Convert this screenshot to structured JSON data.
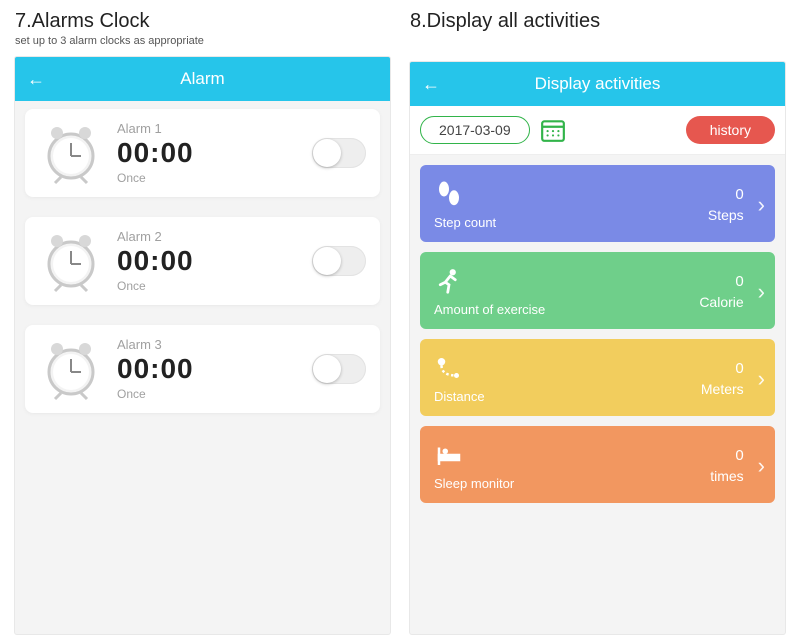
{
  "left": {
    "heading": "7.Alarms Clock",
    "sub": "set up to 3 alarm clocks as appropriate",
    "title": "Alarm",
    "alarms": [
      {
        "label": "Alarm 1",
        "time": "00:00",
        "repeat": "Once"
      },
      {
        "label": "Alarm 2",
        "time": "00:00",
        "repeat": "Once"
      },
      {
        "label": "Alarm 3",
        "time": "00:00",
        "repeat": "Once"
      }
    ]
  },
  "right": {
    "heading": "8.Display all activities",
    "title": "Display activities",
    "date": "2017-03-09",
    "history_label": "history",
    "cards": [
      {
        "label": "Step count",
        "value": "0",
        "unit": "Steps",
        "color": "c-steps",
        "icon": "footprints"
      },
      {
        "label": "Amount of exercise",
        "value": "0",
        "unit": "Calorie",
        "color": "c-exercise",
        "icon": "runner"
      },
      {
        "label": "Distance",
        "value": "0",
        "unit": "Meters",
        "color": "c-distance",
        "icon": "route"
      },
      {
        "label": "Sleep monitor",
        "value": "0",
        "unit": "times",
        "color": "c-sleep",
        "icon": "bed"
      }
    ]
  }
}
